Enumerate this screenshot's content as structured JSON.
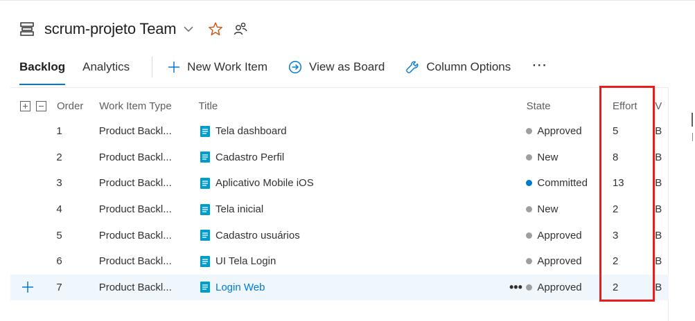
{
  "header": {
    "team_title": "scrum-projeto Team"
  },
  "tabs": [
    {
      "label": "Backlog"
    },
    {
      "label": "Analytics"
    }
  ],
  "toolbar": {
    "new_item": "New Work Item",
    "view_board": "View as Board",
    "column_options": "Column Options",
    "more": "⋯"
  },
  "grid": {
    "columns": {
      "order": "Order",
      "type": "Work Item Type",
      "title": "Title",
      "state": "State",
      "effort": "Effort",
      "v": "V"
    },
    "rows": [
      {
        "order": "1",
        "type": "Product Backl...",
        "title": "Tela dashboard",
        "state": "Approved",
        "effort": "5",
        "v": "B"
      },
      {
        "order": "2",
        "type": "Product Backl...",
        "title": "Cadastro Perfil",
        "state": "New",
        "effort": "8",
        "v": "B"
      },
      {
        "order": "3",
        "type": "Product Backl...",
        "title": "Aplicativo Mobile iOS",
        "state": "Committed",
        "effort": "13",
        "v": "B"
      },
      {
        "order": "4",
        "type": "Product Backl...",
        "title": "Tela inicial",
        "state": "New",
        "effort": "2",
        "v": "B"
      },
      {
        "order": "5",
        "type": "Product Backl...",
        "title": "Cadastro usuários",
        "state": "Approved",
        "effort": "3",
        "v": "B"
      },
      {
        "order": "6",
        "type": "Product Backl...",
        "title": "UI Tela Login",
        "state": "Approved",
        "effort": "2",
        "v": "B"
      },
      {
        "order": "7",
        "type": "Product Backl...",
        "title": "Login Web",
        "state": "Approved",
        "effort": "2",
        "v": "B"
      }
    ],
    "row_more": "•••"
  },
  "colors": {
    "accent": "#0078d4",
    "state_gray": "#a19f9d",
    "state_committed": "#007acc",
    "highlight": "#ea1c1c",
    "pbi_icon": "#009ccc"
  }
}
